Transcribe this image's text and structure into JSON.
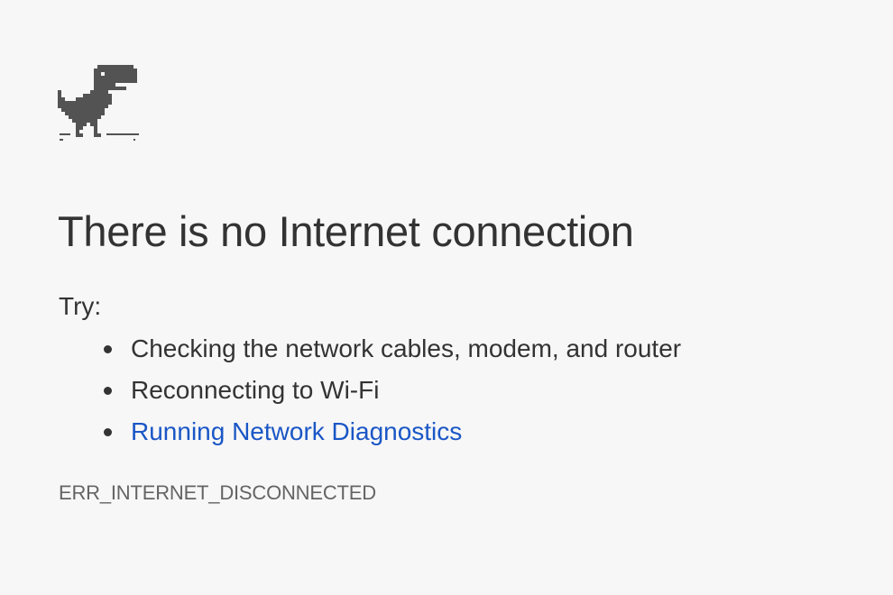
{
  "page": {
    "background_color": "#f7f7f7",
    "title": "There is no Internet connection",
    "try_label": "Try:",
    "suggestions": [
      {
        "label": "Checking the network cables, modem, and router",
        "is_link": false
      },
      {
        "label": "Reconnecting to Wi-Fi",
        "is_link": false
      },
      {
        "label": "Running Network Diagnostics",
        "is_link": true
      }
    ],
    "error_code": "ERR_INTERNET_DISCONNECTED"
  },
  "icons": {
    "offline_dino": "t-rex-dinosaur-icon"
  },
  "colors": {
    "text": "#333333",
    "link": "#1a56c6",
    "error_code": "#646464",
    "dino": "#535353"
  }
}
